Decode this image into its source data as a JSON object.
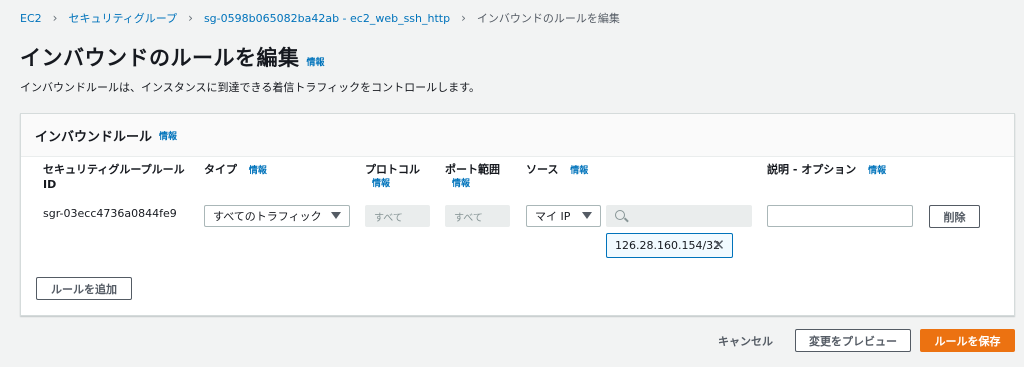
{
  "breadcrumb": {
    "items": [
      "EC2",
      "セキュリティグループ",
      "sg-0598b065082ba42ab - ec2_web_ssh_http"
    ],
    "current": "インバウンドのルールを編集"
  },
  "page": {
    "title": "インバウンドのルールを編集",
    "info": "情報",
    "description": "インバウンドルールは、インスタンスに到達できる着信トラフィックをコントロールします。"
  },
  "panel": {
    "title": "インバウンドルール",
    "info": "情報",
    "columns": {
      "rule_id_line1": "セキュリティグループルール",
      "rule_id_line2": "ID",
      "type": "タイプ",
      "type_info": "情報",
      "protocol": "プロトコル",
      "protocol_info": "情報",
      "port": "ポート範囲",
      "port_info": "情報",
      "source": "ソース",
      "source_info": "情報",
      "description": "説明 - オプション",
      "description_info": "情報"
    },
    "row": {
      "rule_id": "sgr-03ecc4736a0844fe9",
      "type": "すべてのトラフィック",
      "protocol": "すべて",
      "port": "すべて",
      "source_type": "マイ IP",
      "source_search": "",
      "source_token": "126.28.160.154/32",
      "description": "",
      "delete": "削除"
    },
    "add_rule": "ルールを追加"
  },
  "footer": {
    "cancel": "キャンセル",
    "preview": "変更をプレビュー",
    "save": "ルールを保存"
  },
  "icons": {
    "chevron": "chevron-right-icon",
    "caret": "caret-down-icon",
    "search": "search-icon",
    "remove": "close-icon"
  },
  "colors": {
    "link": "#0073bb",
    "primary": "#ec7211",
    "background": "#f2f3f3"
  }
}
